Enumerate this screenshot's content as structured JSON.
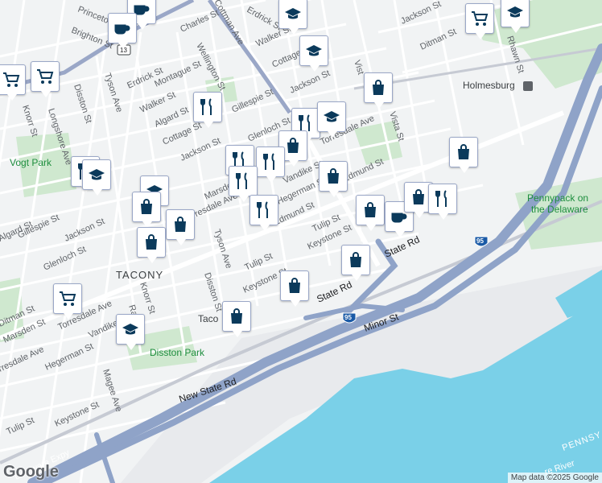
{
  "map": {
    "attribution": "Map data ©2025 Google",
    "logo": "Google",
    "areas": {
      "tacony": "TACONY",
      "holmesburg": "Holmesburg",
      "vogt_park": "Vogt Park",
      "disston_park": "Disston Park",
      "pennypack_line1": "Pennypack on",
      "pennypack_line2": "the Delaware",
      "tacony_partial": "Taco",
      "pennsy": "PENNSY",
      "delaware_river": "re River"
    },
    "streets": {
      "princeton": "Princeton",
      "brighton": "Brighton St",
      "cottman": "Cottman Ave",
      "erdrick_top": "Erdrick St",
      "walker_top": "Walker St",
      "jackson_ne": "Jackson St",
      "ditman": "Ditman St",
      "rhawn": "Rhawn St",
      "charles": "Charles St",
      "wellington": "Wellington St",
      "cottage_top": "Cottage St",
      "jackson_mid": "Jackson St",
      "vista_top": "Vist",
      "tyson": "Tyson Ave",
      "erdrick": "Erdrick St",
      "montague": "Montague St",
      "disston": "Disston St",
      "longshore": "Longshore Ave",
      "knorr_w": "Knorr St",
      "walker": "Walker St",
      "algard": "Algard St",
      "gillespie_mid": "Gillespie St",
      "cottage": "Cottage St",
      "glenloch_mid": "Glenloch St",
      "torresdale_ne": "Torresdale Ave",
      "vista": "Vista St",
      "jackson": "Jackson St",
      "marsden": "Marsden St",
      "vandike": "Vandike St",
      "hegerman": "Hegerman St",
      "edmund_ne": "Edmund St",
      "torresdale_mid": "Torresdale Ave",
      "tulip_ne": "Tulip St",
      "keystone_ne": "Keystone St",
      "state_rd_e": "State Rd",
      "algard_w": "Algard St",
      "gillespie_w": "Gillespie St",
      "jackson_w": "Jackson St",
      "glenloch_w": "Glenloch St",
      "tyson_s": "Tyson Ave",
      "disston_s": "Disston St",
      "tulip": "Tulip St",
      "edmund": "Edmund St",
      "keystone": "Keystone St",
      "state_rd": "State Rd",
      "knorr_s": "Knorr St",
      "ditman_sw": "Ditman St",
      "marsden_sw": "Marsden St",
      "torresdale_sw": "Torresdale Ave",
      "vandike_sw": "Vandike St",
      "rawle": "Rawle St",
      "torresdale_far": "rresdale Ave",
      "hegerman_sw": "Hegerman St",
      "magee": "Magee Ave",
      "new_state_rd": "New State Rd",
      "keystone_sw": "Keystone St",
      "tulip_sw": "Tulip St",
      "minor": "Minor St",
      "delaware_expy": "Delaware Expy",
      "i95": "95",
      "us13": "13"
    },
    "colors": {
      "land": "#f1f3f4",
      "water": "#7ad0e8",
      "park": "#cfe8cf",
      "highway": "#8fa3c8",
      "marker_icon": "#0b3a5b"
    }
  }
}
